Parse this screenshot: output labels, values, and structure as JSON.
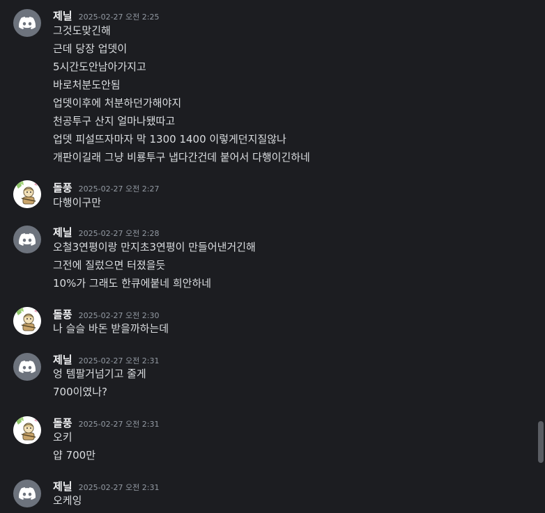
{
  "messages": [
    {
      "user": "제닐",
      "avatar": "discord-logo-avatar",
      "time": "2025-02-27 오전 2:25",
      "lines": [
        "그것도맞긴해",
        "근데 당장 업뎃이",
        "5시간도안남아가지고",
        "바로처분도안됨",
        "업뎃이후에 처분하던가해야지",
        "천공투구 산지 얼마나됐따고",
        "업뎃 피설뜨자마자 막 1300 1400 이렇게던지질않나",
        "개판이길래 그냥 비룡투구 냅다간건데 붙어서 다행이긴하네"
      ]
    },
    {
      "user": "돌풍",
      "avatar": "character-avatar",
      "time": "2025-02-27 오전 2:27",
      "lines": [
        "다행이구만"
      ]
    },
    {
      "user": "제닐",
      "avatar": "discord-logo-avatar",
      "time": "2025-02-27 오전 2:28",
      "lines": [
        "오철3연평이랑 만지초3연평이 만들어낸거긴해",
        "그전에 질렀으면 터졌을듯",
        "10%가 그래도 한큐에붙네 희안하네"
      ]
    },
    {
      "user": "돌풍",
      "avatar": "character-avatar",
      "time": "2025-02-27 오전 2:30",
      "lines": [
        "나 슬슬 바돈 받을까하는데"
      ]
    },
    {
      "user": "제닐",
      "avatar": "discord-logo-avatar",
      "time": "2025-02-27 오전 2:31",
      "lines": [
        "엉 템팔거넘기고 줄게",
        "700이였나?"
      ]
    },
    {
      "user": "돌풍",
      "avatar": "character-avatar",
      "time": "2025-02-27 오전 2:31",
      "lines": [
        "오키",
        "얍 700만"
      ]
    },
    {
      "user": "제닐",
      "avatar": "discord-logo-avatar",
      "time": "2025-02-27 오전 2:31",
      "lines": [
        "오케잉"
      ]
    }
  ],
  "colors": {
    "background": "#1c1d21",
    "username": "#f2f3f5",
    "text": "#dbdee1",
    "timestamp": "#949ba4",
    "discord_avatar_bg": "#6d737d"
  }
}
